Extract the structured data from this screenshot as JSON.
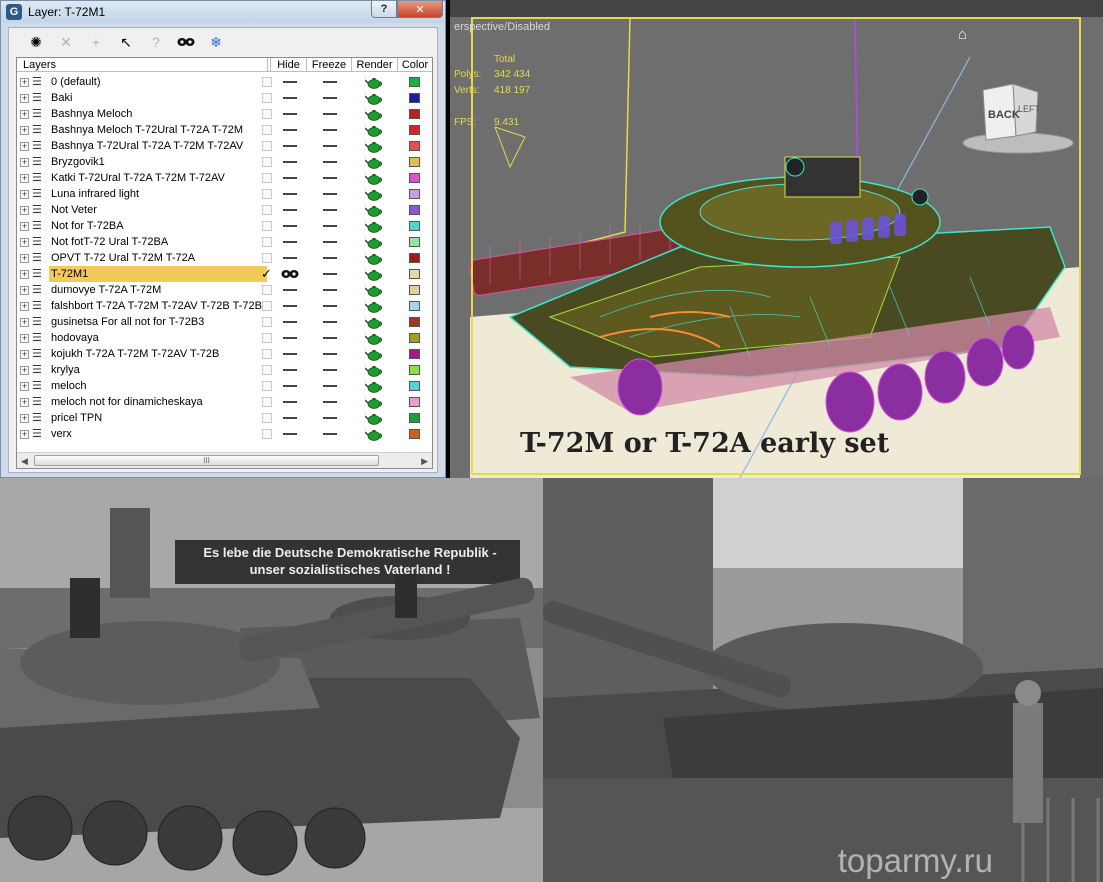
{
  "window": {
    "title": "Layer: T-72M1",
    "help_label": "?",
    "close_label": "✕",
    "app_icon_letter": "G"
  },
  "toolbar": {
    "buttons": [
      {
        "name": "create-layer",
        "icon": "✺",
        "enabled": true
      },
      {
        "name": "delete-layer",
        "icon": "✕",
        "enabled": false
      },
      {
        "name": "add-to-layer",
        "icon": "+",
        "enabled": false
      },
      {
        "name": "select-objects",
        "icon": "↖",
        "enabled": true
      },
      {
        "name": "highlight-layer",
        "icon": "?",
        "enabled": false
      },
      {
        "name": "hide-all",
        "icon": "◉",
        "enabled": true
      },
      {
        "name": "freeze-all",
        "icon": "❄",
        "enabled": true
      }
    ]
  },
  "table": {
    "headers": {
      "layers": "Layers",
      "hide": "Hide",
      "freeze": "Freeze",
      "render": "Render",
      "color": "Color"
    },
    "rows": [
      {
        "name": "0 (default)",
        "color": "#19b13c"
      },
      {
        "name": "Baki",
        "color": "#1a1aa6"
      },
      {
        "name": "Bashnya Meloch",
        "color": "#b82222"
      },
      {
        "name": "Bashnya Meloch T-72Ural T-72A T-72M",
        "color": "#d62424"
      },
      {
        "name": "Bashnya T-72Ural T-72A T-72M T-72AV",
        "color": "#e85050"
      },
      {
        "name": "Bryzgovik1",
        "color": "#e2be52"
      },
      {
        "name": "Katki T-72Ural T-72A T-72M T-72AV",
        "color": "#e052c8"
      },
      {
        "name": "Luna infrared light",
        "color": "#c89ee0"
      },
      {
        "name": "Not Veter",
        "color": "#8c54d6"
      },
      {
        "name": "Not for T-72BA",
        "color": "#4ed6c6"
      },
      {
        "name": "Not fotT-72 Ural T-72BA",
        "color": "#8ee6a0"
      },
      {
        "name": "OPVT T-72 Ural T-72M T-72A",
        "color": "#a01818"
      },
      {
        "name": "T-72M1",
        "color": "#e6d6a6",
        "selected": true
      },
      {
        "name": "dumovye T-72A T-72M",
        "color": "#e0d0a0"
      },
      {
        "name": "falshbort T-72A T-72M T-72AV T-72B T-72B",
        "color": "#a6d6e6"
      },
      {
        "name": "gusinetsa For all not for T-72B3",
        "color": "#9c3a1a"
      },
      {
        "name": "hodovaya",
        "color": "#a0a020"
      },
      {
        "name": "kojukh T-72A T-72M T-72AV T-72B",
        "color": "#a01a8a"
      },
      {
        "name": "krylya",
        "color": "#8ee050"
      },
      {
        "name": "meloch",
        "color": "#4ed6d6"
      },
      {
        "name": "meloch not for dinamicheskaya",
        "color": "#e8a0c8"
      },
      {
        "name": "pricel TPN",
        "color": "#19a03c"
      },
      {
        "name": "verx",
        "color": "#c8641a"
      }
    ],
    "scroll_thumb_label": "III"
  },
  "viewport": {
    "label": "erspective/Disabled",
    "stats": {
      "total_label": "Total",
      "polys_label": "Polys:",
      "polys_value": "342 434",
      "verts_label": "Verts:",
      "verts_value": "418 197",
      "fps_label": "FPS:",
      "fps_value": "9.431"
    },
    "viewcube": {
      "back": "BACK",
      "left": "LEFT"
    },
    "caption": "T-72M or T-72A early set"
  },
  "photos": {
    "banner_line1": "Es lebe die Deutsche Demokratische Republik -",
    "banner_line2": "unser sozialistisches Vaterland !",
    "watermark": "toparmy.ru"
  }
}
